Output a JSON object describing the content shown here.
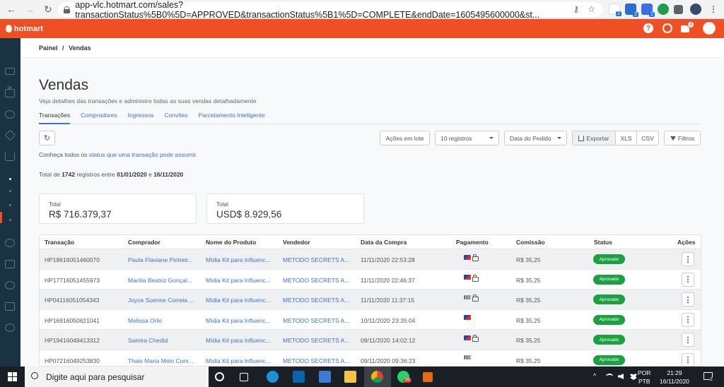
{
  "browser": {
    "url": "app-vlc.hotmart.com/sales?transactionStatus%5B0%5D=APPROVED&transactionStatus%5B1%5D=COMPLETE&endDate=1605495600000&st...",
    "back": "←",
    "forward": "→",
    "reload": "↻",
    "key_icon": "⚷",
    "star_icon": "☆",
    "ext_badge_1": "2",
    "ext_badge_2": "2",
    "ext_badge_3": "2"
  },
  "hotmart_bar": {
    "logo": "hotmart",
    "help": "?",
    "notif_count": "4"
  },
  "breadcrumb": {
    "home": "Painel",
    "sep": "/",
    "current": "Vendas"
  },
  "page": {
    "title": "Vendas",
    "subtitle": "Veja detalhes das transações e administre todas as suas vendas detalhadamente"
  },
  "tabs": [
    "Transações",
    "Compradores",
    "Ingressos",
    "Convites",
    "Parcelamento Inteligente"
  ],
  "toolbar": {
    "refresh": "↻",
    "actions": "Ações em lote",
    "registros": "10 registros",
    "date_type": "Data do Pedido",
    "export": "Exportar",
    "xls": "XLS",
    "csv": "CSV",
    "filters": "Filtros"
  },
  "info": {
    "know_prefix": "Conheça todos os",
    "know_link": "status que uma transação pode assumir.",
    "total_prefix": "Total de",
    "total_count": "1742",
    "total_mid": "registros entre",
    "date_from": "01/01/2020",
    "date_and": "e",
    "date_to": "16/11/2020"
  },
  "cards": [
    {
      "label": "Total",
      "value": "R$ 716.379,37"
    },
    {
      "label": "Total",
      "value": "USD$ 8.929,56"
    }
  ],
  "table": {
    "headers": [
      "Transação",
      "Comprador",
      "Nome do Produto",
      "Vendedor",
      "Data da Compra",
      "Pagamento",
      "Comissão",
      "Status",
      "Ações"
    ],
    "rows": [
      {
        "id": "HP18616051460070",
        "buyer": "Paula Flaviane Pinheir...",
        "product": "Mídia Kit para Influenc...",
        "seller": "METODO SECRETS A...",
        "date": "11/11/2020 22:53:28",
        "payment": "card-lock",
        "commission": "R$ 35,25",
        "status": "Aprovado"
      },
      {
        "id": "HP17716051455973",
        "buyer": "Marília Beatriz Gonçal...",
        "product": "Mídia Kit para Influenc...",
        "seller": "METODO SECRETS A...",
        "date": "11/11/2020 22:46:37",
        "payment": "card-lock",
        "commission": "R$ 35,25",
        "status": "Aprovado"
      },
      {
        "id": "HP04116051054343",
        "buyer": "Joyce Suenne Correia ...",
        "product": "Mídia Kit para Influenc...",
        "seller": "METODO SECRETS A...",
        "date": "11/11/2020 11:37:15",
        "payment": "boleto-lock",
        "commission": "R$ 35,25",
        "status": "Aprovado"
      },
      {
        "id": "HP16916050621041",
        "buyer": "Melissa Orlic",
        "product": "Mídia Kit para Influenc...",
        "seller": "METODO SECRETS A...",
        "date": "10/11/2020 23:35:04",
        "payment": "card",
        "commission": "R$ 35,25",
        "status": "Aprovado"
      },
      {
        "id": "HP19416049413312",
        "buyer": "Samira Chedid",
        "product": "Mídia Kit para Influenc...",
        "seller": "METODO SECRETS A...",
        "date": "09/11/2020 14:02:12",
        "payment": "card-lock",
        "commission": "R$ 35,25",
        "status": "Aprovado"
      },
      {
        "id": "HP07216049253830",
        "buyer": "Thais Maria Melo Conr...",
        "product": "Mídia Kit para Influenc...",
        "seller": "METODO SECRETS A...",
        "date": "09/11/2020 09:36:23",
        "payment": "boleto",
        "commission": "R$ 35,25",
        "status": "Aprovado"
      }
    ],
    "action_glyph": "⋮"
  },
  "taskbar": {
    "search_placeholder": "Digite aqui para pesquisar",
    "whatsapp_badge": "99",
    "lang_top": "POR",
    "lang_bottom": "PTB",
    "time": "21:29",
    "date": "16/11/2020",
    "notif_count": "2",
    "caret": "^"
  }
}
